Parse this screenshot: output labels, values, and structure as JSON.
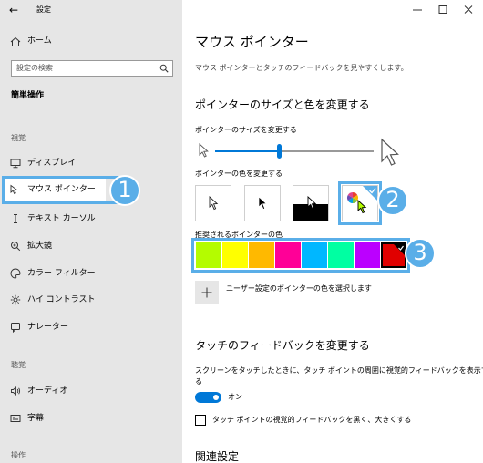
{
  "window": {
    "title": "設定"
  },
  "sidebar": {
    "home_label": "ホーム",
    "search_placeholder": "設定の検索",
    "category_title": "簡単操作",
    "group_vision": "視覚",
    "items": [
      {
        "label": "ディスプレイ",
        "icon": "monitor-icon"
      },
      {
        "label": "マウス ポインター",
        "icon": "mouse-pointer-icon"
      },
      {
        "label": "テキスト カーソル",
        "icon": "text-cursor-icon"
      },
      {
        "label": "拡大鏡",
        "icon": "magnifier-icon"
      },
      {
        "label": "カラー フィルター",
        "icon": "palette-icon"
      },
      {
        "label": "ハイ コントラスト",
        "icon": "contrast-icon"
      },
      {
        "label": "ナレーター",
        "icon": "narrator-icon"
      }
    ],
    "group_hearing": "聴覚",
    "hearing_items": [
      {
        "label": "オーディオ",
        "icon": "speaker-icon"
      },
      {
        "label": "字幕",
        "icon": "captions-icon"
      }
    ],
    "group_interaction": "操作"
  },
  "main": {
    "page_title": "マウス ポインター",
    "description": "マウス ポインターとタッチのフィードバックを見やすくします。",
    "section_size_color": "ポインターのサイズと色を変更する",
    "size_label": "ポインターのサイズを変更する",
    "size_value_fraction": 0.4,
    "color_label": "ポインターの色を変更する",
    "pointer_styles": [
      "white",
      "black",
      "inverted",
      "custom"
    ],
    "selected_style": "custom",
    "recommended_label": "推奨されるポインターの色",
    "recommended_colors": [
      "#b4fc00",
      "#ffff00",
      "#ffb900",
      "#ff0097",
      "#00b7ff",
      "#00ffa2",
      "#bb00ff",
      "#e00000"
    ],
    "selected_color_index": 7,
    "custom_color_label": "ユーザー設定のポインターの色を選択します",
    "section_touch": "タッチのフィードバックを変更する",
    "touch_description_line1": "スクリーンをタッチしたときに、タッチ ポイントの周囲に視覚的フィードバックを表示す",
    "touch_description_line2": "る",
    "touch_toggle_state": "オン",
    "touch_toggle_on": true,
    "dark_feedback_label": "タッチ ポイントの視覚的フィードバックを黒く、大きくする",
    "dark_feedback_checked": false,
    "related_title": "関連設定"
  },
  "callouts": [
    "1",
    "2",
    "3"
  ],
  "colors": {
    "accent": "#5aaee8",
    "toggle": "#0078d7"
  }
}
